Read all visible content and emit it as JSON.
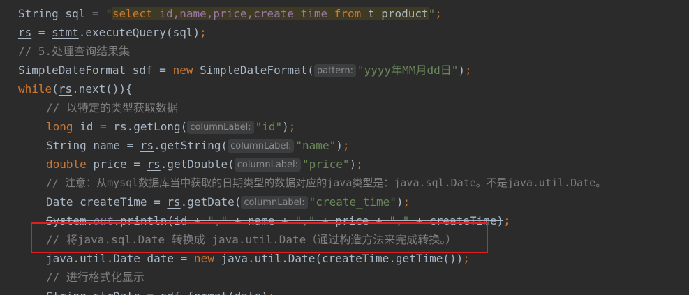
{
  "code_lines": {
    "l1": {
      "a": "String sql = ",
      "q1": "\"",
      "sql_select": "select",
      "sql_sp1": " ",
      "sql_cols": "id,name,price,create_time",
      "sql_sp2": " ",
      "sql_from": "from",
      "sql_sp3": " ",
      "sql_table": "t_product",
      "q2": "\"",
      "end": ";"
    },
    "l2": {
      "rs": "rs",
      "eq": " = ",
      "stmt": "stmt",
      "call": ".executeQuery(sql)",
      "end": ";"
    },
    "l3": {
      "comment": "// 5.处理查询结果集"
    },
    "l4": {
      "a": "SimpleDateFormat sdf = ",
      "new": "new",
      "b": " SimpleDateFormat(",
      "hint": "pattern:",
      "str": "\"yyyy年MM月dd日\"",
      "c": ")",
      "end": ";"
    },
    "l5": {
      "while": "while",
      "a": "(",
      "rs": "rs",
      "b": ".next()){"
    },
    "l6": {
      "comment": "// 以特定的类型获取数据"
    },
    "l7": {
      "type": "long",
      "a": " id = ",
      "rs": "rs",
      "b": ".getLong(",
      "hint": "columnLabel:",
      "str": "\"id\"",
      "c": ")",
      "end": ";"
    },
    "l8": {
      "a": "String name = ",
      "rs": "rs",
      "b": ".getString(",
      "hint": "columnLabel:",
      "str": "\"name\"",
      "c": ")",
      "end": ";"
    },
    "l9": {
      "type": "double",
      "a": " price = ",
      "rs": "rs",
      "b": ".getDouble(",
      "hint": "columnLabel:",
      "str": "\"price\"",
      "c": ")",
      "end": ";"
    },
    "l10": {
      "comment": "// 注意：从mysql数据库当中获取的日期类型的数据对应的java类型是：java.sql.Date。不是java.util.Date。"
    },
    "l11": {
      "a": "Date createTime = ",
      "rs": "rs",
      "b": ".getDate(",
      "hint": "columnLabel:",
      "str": "\"create_time\"",
      "c": ")",
      "end": ";"
    },
    "l12": {
      "a": "System.",
      "out": "out",
      "b": ".println(id + ",
      "s1": "\",\"",
      "c": " + name + ",
      "s2": "\",\"",
      "d": " + price + ",
      "s3": "\",\"",
      "e": " + createTime)",
      "end": ";"
    },
    "l13": {
      "comment": "// 将java.sql.Date 转换成 java.util.Date（通过构造方法来完成转换。）"
    },
    "l14": {
      "a": "java.util.Date date = ",
      "new": "new",
      "b": " java.util.Date(createTime.getTime())",
      "end": ";"
    },
    "l15": {
      "comment": "// 进行格式化显示"
    },
    "l16": {
      "a": "String strDate = sdf.format(date)",
      "end": ";"
    }
  },
  "colors": {
    "background": "#2b2b2b",
    "keyword": "#cc7832",
    "string": "#6a8759",
    "comment": "#808080",
    "highlight_box": "#e02020"
  }
}
